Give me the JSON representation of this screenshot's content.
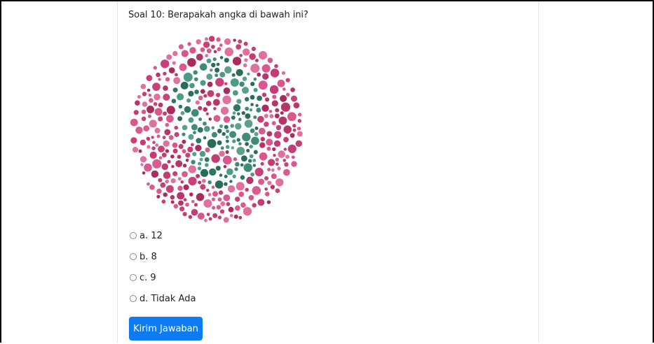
{
  "question": {
    "text": "Soal 10: Berapakah angka di bawah ini?"
  },
  "plate": {
    "hidden_number": "9",
    "colors": {
      "background_dots": [
        "#c9417a",
        "#d9568e",
        "#b73569",
        "#e0719f",
        "#a82c5f",
        "#d85c91",
        "#c23d75"
      ],
      "figure_dots": [
        "#3f8a78",
        "#2f7765",
        "#4f9a86",
        "#2b6b5b",
        "#5aa08d"
      ]
    }
  },
  "options": [
    {
      "label": "a. 12"
    },
    {
      "label": "b. 8"
    },
    {
      "label": "c. 9"
    },
    {
      "label": "d. Tidak Ada"
    }
  ],
  "submit": {
    "label": "Kirim Jawaban",
    "color": "#0d7cf2"
  }
}
